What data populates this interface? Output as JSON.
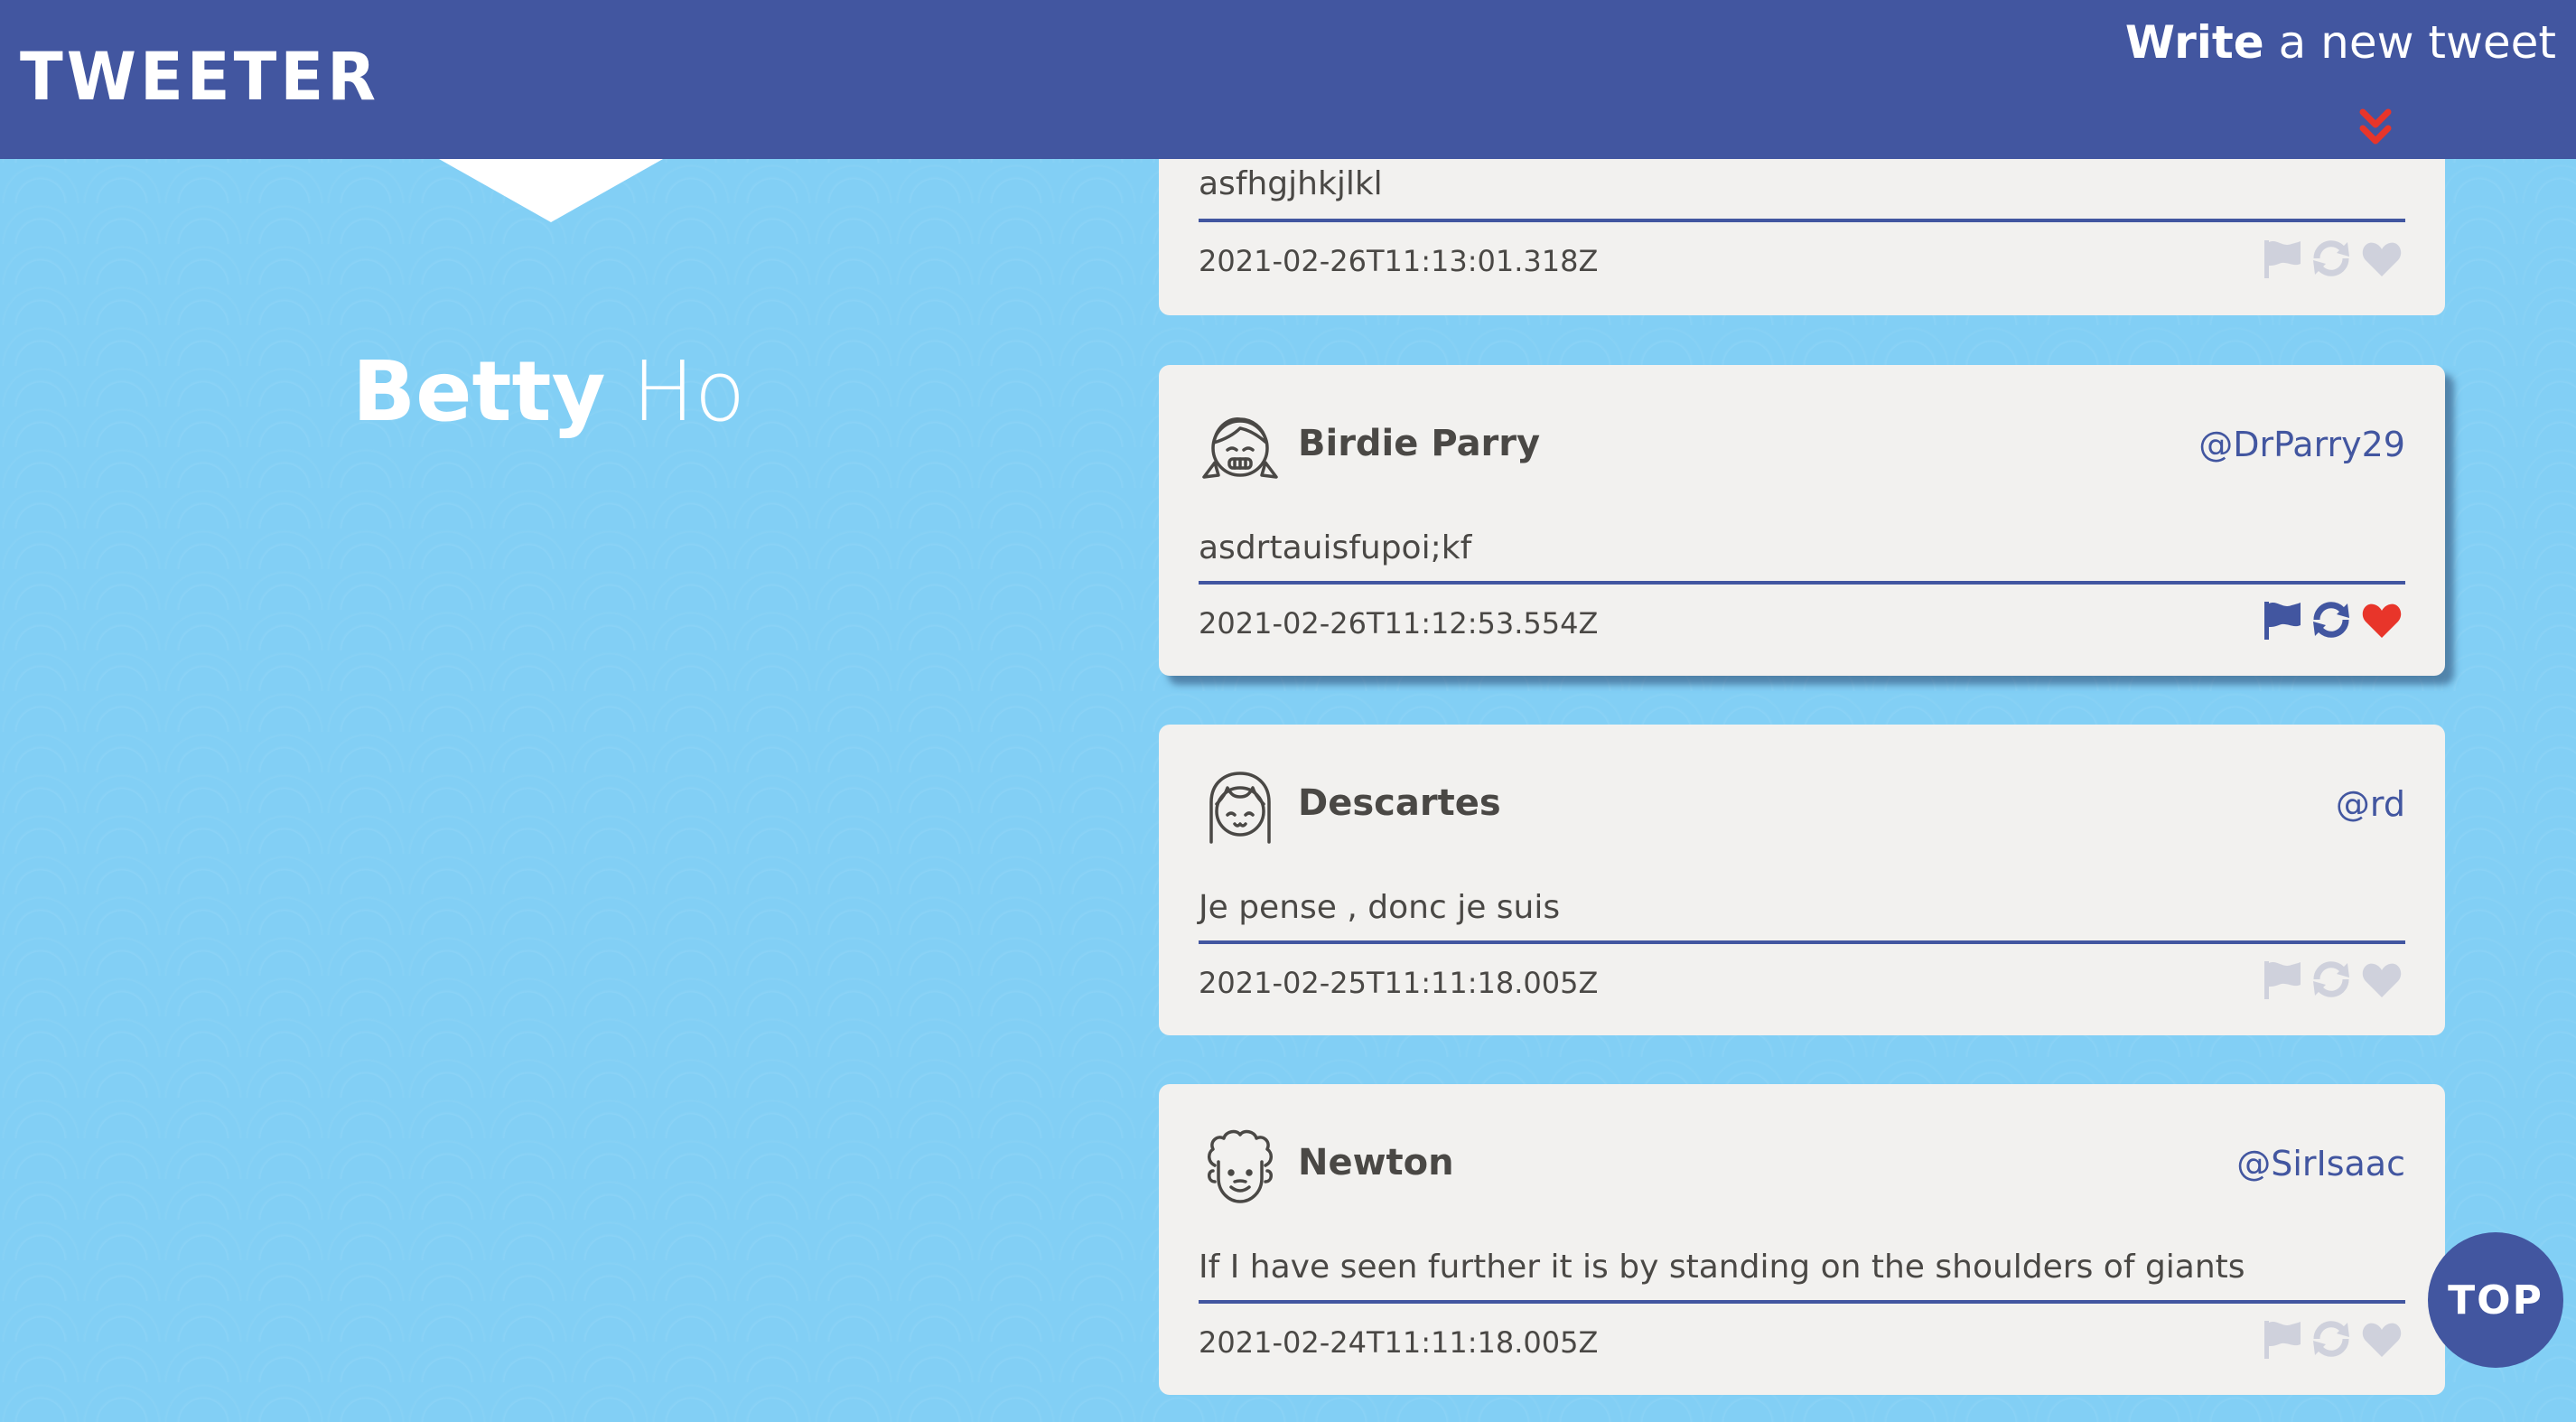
{
  "header": {
    "brand": "TWEETER",
    "write_bold": "Write",
    "write_rest": " a new tweet"
  },
  "profile": {
    "first_name": "Betty",
    "last_name": "Ho"
  },
  "tweets": [
    {
      "text": "asfhgjhkjlkl",
      "timestamp": "2021-02-26T11:13:01.318Z"
    },
    {
      "author": "Birdie Parry",
      "handle": "@DrParry29",
      "text": "asdrtauisfupoi;kf",
      "timestamp": "2021-02-26T11:12:53.554Z",
      "avatar_icon": "girl-pigtails-avatar-icon"
    },
    {
      "author": "Descartes",
      "handle": "@rd",
      "text": "Je pense , donc je suis",
      "timestamp": "2021-02-25T11:11:18.005Z",
      "avatar_icon": "girl-bangs-avatar-icon"
    },
    {
      "author": "Newton",
      "handle": "@SirIsaac",
      "text": "If I have seen further it is by standing on the shoulders of giants",
      "timestamp": "2021-02-24T11:11:18.005Z",
      "avatar_icon": "curly-hair-man-avatar-icon"
    }
  ],
  "top_button": "TOP",
  "colors": {
    "nav": "#4256a0",
    "background": "#82cff5",
    "card": "#f2f1ef",
    "accent_red": "#e8352a",
    "icon_inactive": "#cfd1dc"
  }
}
